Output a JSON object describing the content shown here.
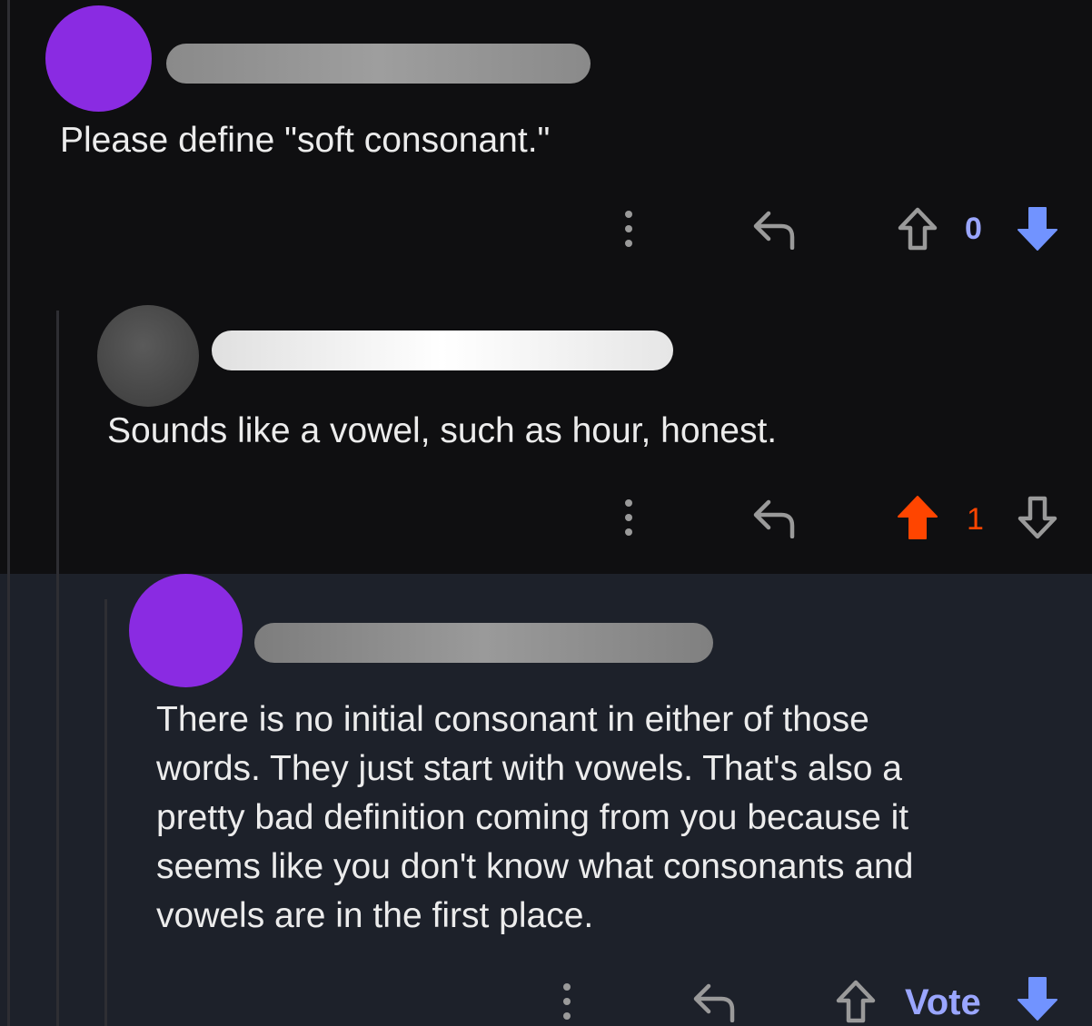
{
  "colors": {
    "background": "#0f0f11",
    "highlight_background": "#1d212a",
    "upvote_active": "#ff4500",
    "downvote_active": "#7193ff",
    "icon_gray": "#9a9a9a",
    "avatar_purple": "#8a2be2",
    "avatar_gray": "#4a4a4a"
  },
  "comments": [
    {
      "avatar": "avatar-purple",
      "text": "Please define \"soft consonant.\"",
      "score": "0",
      "vote_state": "downvoted"
    },
    {
      "avatar": "avatar-gray",
      "text": "Sounds like a vowel, such as hour, honest.",
      "score": "1",
      "vote_state": "upvoted"
    },
    {
      "avatar": "avatar-purple",
      "text": "There is no initial consonant in either of those\nwords. They just start with vowels. That's also a\npretty bad definition coming from you because it\nseems like you don't know what consonants and\nvowels are in the first place.",
      "score": "Vote",
      "vote_state": "downvoted"
    }
  ],
  "icons": {
    "more": "more-vertical-icon",
    "reply": "reply-icon",
    "upvote": "upvote-arrow-icon",
    "downvote": "downvote-arrow-icon"
  }
}
